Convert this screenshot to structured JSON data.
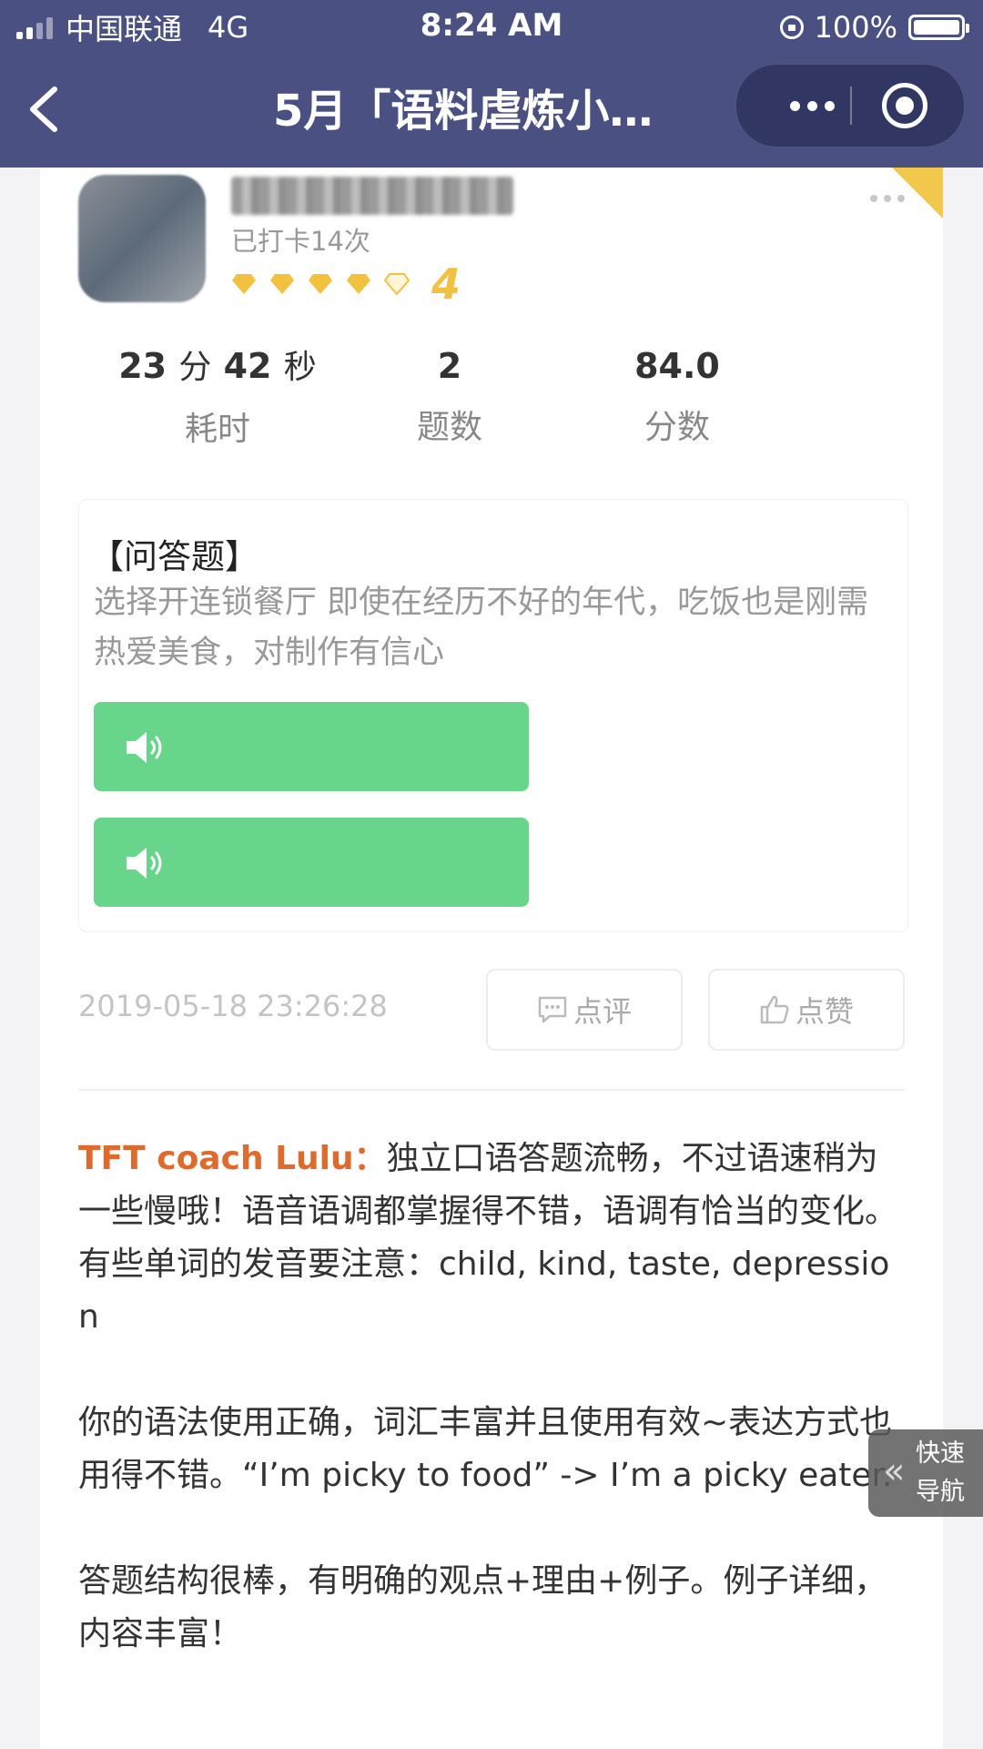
{
  "status_bar": {
    "carrier": "中国联通",
    "network": "4G",
    "time": "8:24 AM",
    "battery": "100%"
  },
  "nav": {
    "title": "5月「语料虐炼小…"
  },
  "user": {
    "checkin_text": "已打卡14次",
    "level": "4",
    "gems_filled": 4,
    "gems_total": 5
  },
  "stats": {
    "time_minutes": "23",
    "time_min_unit": "分",
    "time_seconds": "42",
    "time_sec_unit": "秒",
    "time_label": "耗时",
    "questions": "2",
    "questions_label": "题数",
    "score": "84.0",
    "score_label": "分数"
  },
  "question": {
    "type_label": "【问答题】",
    "prompt": "选择开连锁餐厅 即使在经历不好的年代，吃饭也是刚需 热爱美食，对制作有信心"
  },
  "post": {
    "timestamp": "2019-05-18 23:26:28",
    "comment_button": "点评",
    "like_button": "点赞"
  },
  "feedback": {
    "author": "TFT coach Lulu：",
    "para1": "独立口语答题流畅，不过语速稍为一些慢哦！语音语调都掌握得不错，语调有恰当的变化。有些单词的发音要注意：child, kind, taste, depression",
    "para2": "你的语法使用正确，词汇丰富并且使用有效~表达方式也用得不错。“I’m picky to food” -> I’m a picky eater.",
    "para3": "答题结构很棒，有明确的观点+理由+例子。例子详细，内容丰富！"
  },
  "quick_nav": {
    "line1": "快速",
    "line2": "导航"
  },
  "colors": {
    "nav_bg": "#4a5082",
    "audio_green": "#67d68a",
    "author_orange": "#e06a2c",
    "gem_gold": "#f2c23e"
  }
}
